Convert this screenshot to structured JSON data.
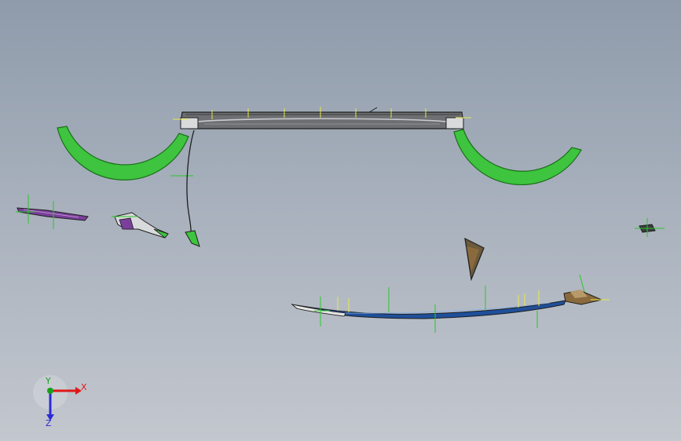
{
  "viewport": {
    "background_top": "#8f9bab",
    "background_bottom": "#c3c7ce"
  },
  "triad": {
    "x_label": "X",
    "y_label": "Y",
    "z_label": "Z",
    "x_color": "#e01818",
    "y_color": "#18a018",
    "z_color": "#2a2ad8"
  },
  "colors": {
    "green_part": "#3ec43e",
    "green_edge": "#1a6e1a",
    "gray_part": "#6d6f72",
    "dark_edge": "#1e1e1e",
    "blue_part": "#1f4f9a",
    "brown_part": "#8a6a3c",
    "purple_part": "#7a3f9a",
    "annotation_yellow": "#e8e84a",
    "annotation_green": "#28c828"
  },
  "icons": {
    "triad": "coordinate-triad-icon"
  }
}
